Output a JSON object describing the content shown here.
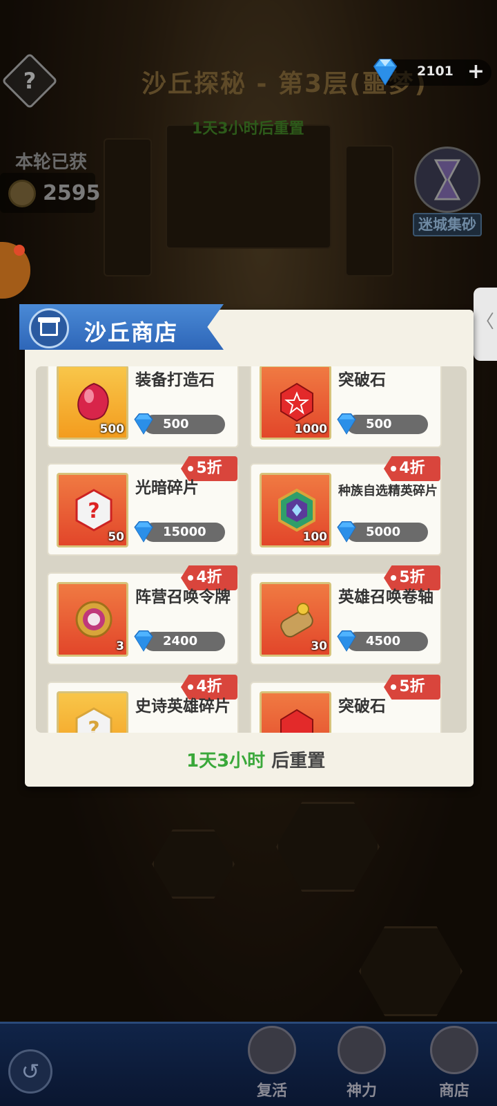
{
  "header": {
    "help_symbol": "?",
    "level_title": "沙丘探秘 - 第3层(噩梦)",
    "reset_notice": "1天3小时后重置",
    "gems": "2101",
    "plus_symbol": "+"
  },
  "earned": {
    "label": "本轮已获",
    "value": "2595"
  },
  "hourglass": {
    "label": "迷城集砂"
  },
  "side_tab": {
    "symbol": "〈"
  },
  "shop": {
    "title": "沙丘商店",
    "items": [
      {
        "name": "装备打造石",
        "qty": "500",
        "price": "500",
        "discount": ""
      },
      {
        "name": "突破石",
        "qty": "1000",
        "price": "500",
        "discount": ""
      },
      {
        "name": "光暗碎片",
        "qty": "50",
        "price": "15000",
        "discount": "5折"
      },
      {
        "name": "种族自选精英碎片",
        "qty": "100",
        "price": "5000",
        "discount": "4折"
      },
      {
        "name": "阵营召唤令牌",
        "qty": "3",
        "price": "2400",
        "discount": "4折"
      },
      {
        "name": "英雄召唤卷轴",
        "qty": "30",
        "price": "4500",
        "discount": "5折"
      },
      {
        "name": "史诗英雄碎片",
        "qty": "",
        "price": "",
        "discount": "4折"
      },
      {
        "name": "突破石",
        "qty": "",
        "price": "",
        "discount": "5折"
      }
    ],
    "reset_time": "1天3小时",
    "reset_suffix": " 后重置"
  },
  "bottom_nav": {
    "back_symbol": "↺",
    "items": [
      {
        "label": "复活",
        "icon": "heart-shield-icon"
      },
      {
        "label": "神力",
        "icon": "fist-icon"
      },
      {
        "label": "商店",
        "icon": "scales-icon"
      }
    ]
  },
  "colors": {
    "accent_blue": "#2e66b8",
    "discount_red": "#d9453c",
    "timer_green": "#3aa83a"
  }
}
